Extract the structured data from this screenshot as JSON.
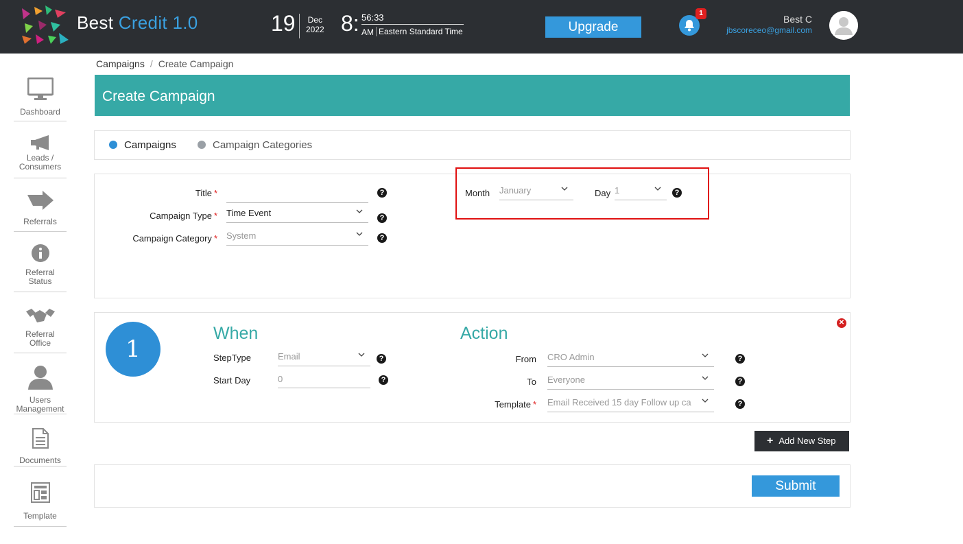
{
  "header": {
    "brand_prefix": "Best",
    "brand_accent": "Credit 1.0",
    "date_day": "19",
    "date_month": "Dec",
    "date_year": "2022",
    "time_hour": "8:",
    "time_minsec": "56:33",
    "time_ampm": "AM",
    "time_zone": "Eastern Standard Time",
    "upgrade_label": "Upgrade",
    "notification_count": "1",
    "user_name": "Best C",
    "user_email": "jbscoreceo@gmail.com",
    "accent_color": "#3498db",
    "bar_color": "#2c2f33"
  },
  "sidebar": {
    "items": [
      {
        "label": "Dashboard",
        "icon": "monitor-icon"
      },
      {
        "label": "Leads / Consumers",
        "icon": "megaphone-icon"
      },
      {
        "label": "Referrals",
        "icon": "arrow-icon"
      },
      {
        "label": "Referral Status",
        "icon": "info-icon"
      },
      {
        "label": "Referral Office",
        "icon": "handshake-icon"
      },
      {
        "label": "Users Management",
        "icon": "user-icon"
      },
      {
        "label": "Documents",
        "icon": "document-icon"
      },
      {
        "label": "Template",
        "icon": "template-icon"
      }
    ]
  },
  "breadcrumb": {
    "root": "Campaigns",
    "separator": "/",
    "current": "Create Campaign"
  },
  "page": {
    "title": "Create Campaign",
    "header_color": "#36a9a6"
  },
  "tabs": [
    {
      "label": "Campaigns",
      "active": true,
      "dot_color": "#2e8fd6"
    },
    {
      "label": "Campaign Categories",
      "active": false,
      "dot_color": "#9aa0a6"
    }
  ],
  "form": {
    "title_label": "Title",
    "title_value": "",
    "type_label": "Campaign Type",
    "type_value": "Time Event",
    "category_label": "Campaign Category",
    "category_value": "System",
    "month_label": "Month",
    "month_value": "January",
    "day_label": "Day",
    "day_value": "1",
    "required_mark": "*",
    "help_glyph": "?"
  },
  "step": {
    "number": "1",
    "when_title": "When",
    "steptype_label": "StepType",
    "steptype_value": "Email",
    "startday_label": "Start Day",
    "startday_value": "0",
    "action_title": "Action",
    "from_label": "From",
    "from_value": "CRO Admin",
    "to_label": "To",
    "to_value": "Everyone",
    "template_label": "Template",
    "template_value": "Email Received 15 day Follow up ca"
  },
  "actions": {
    "add_step_label": "Add New Step",
    "add_step_glyph": "+",
    "submit_label": "Submit"
  }
}
